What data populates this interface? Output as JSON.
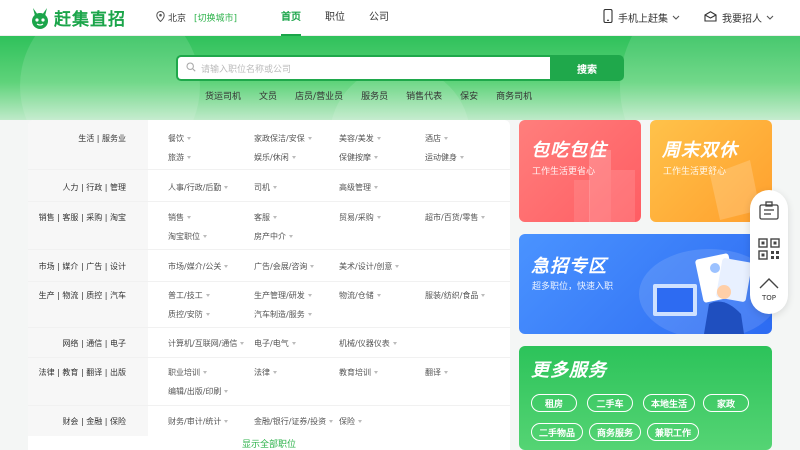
{
  "header": {
    "logo_text": "赶集直招",
    "location": {
      "city": "北京",
      "switch": "[切换城市]"
    },
    "nav": [
      "首页",
      "职位",
      "公司"
    ],
    "mobile_link": "手机上赶集",
    "hire_link": "我要招人"
  },
  "search": {
    "placeholder": "请输入职位名称或公司",
    "button": "搜索",
    "hot_keywords": [
      "货运司机",
      "文员",
      "店员/营业员",
      "服务员",
      "销售代表",
      "保安",
      "商务司机"
    ]
  },
  "categories": [
    {
      "label": "生活 | 服务业",
      "items": [
        "餐饮",
        "家政保洁/安保",
        "美容/美发",
        "酒店",
        "旅游",
        "娱乐/休闲",
        "保健按摩",
        "运动健身"
      ]
    },
    {
      "label": "人力 | 行政 | 管理",
      "items": [
        "人事/行政/后勤",
        "司机",
        "高级管理"
      ]
    },
    {
      "label": "销售 | 客服 | 采购 | 淘宝",
      "items": [
        "销售",
        "客服",
        "贸易/采购",
        "超市/百货/零售",
        "淘宝职位",
        "房产中介"
      ]
    },
    {
      "label": "市场 | 媒介 | 广告 | 设计",
      "items": [
        "市场/媒介/公关",
        "广告/会展/咨询",
        "美术/设计/创意"
      ]
    },
    {
      "label": "生产 | 物流 | 质控 | 汽车",
      "items": [
        "普工/技工",
        "生产管理/研发",
        "物流/仓储",
        "服装/纺织/食品",
        "质控/安防",
        "汽车制造/服务"
      ]
    },
    {
      "label": "网络 | 通信 | 电子",
      "items": [
        "计算机/互联网/通信",
        "电子/电气",
        "机械/仪器仪表"
      ]
    },
    {
      "label": "法律 | 教育 | 翻译 | 出版",
      "items": [
        "职业培训",
        "法律",
        "教育培训",
        "翻译",
        "编辑/出版/印刷"
      ]
    },
    {
      "label": "财会 | 金融 | 保险",
      "items": [
        "财务/审计/统计",
        "金融/银行/证券/投资",
        "保险"
      ]
    }
  ],
  "show_all": "显示全部职位",
  "promos": {
    "card1": {
      "title": "包吃包住",
      "subtitle": "工作生活更省心"
    },
    "card2": {
      "title": "周末双休",
      "subtitle": "工作生活更舒心"
    },
    "card3": {
      "title": "急招专区",
      "subtitle": "超多职位，快速入职"
    },
    "card4": {
      "title": "更多服务",
      "services": [
        "租房",
        "二手车",
        "本地生活",
        "家政",
        "二手物品",
        "商务服务",
        "兼职工作"
      ]
    }
  },
  "float_bar": {
    "top_label": "TOP"
  },
  "colors": {
    "brand_green": "#1ba54a",
    "banner_green": "#2fc15b",
    "card_red": "#ff6b6e",
    "card_orange": "#ffb03a",
    "card_blue": "#3d82fa"
  }
}
